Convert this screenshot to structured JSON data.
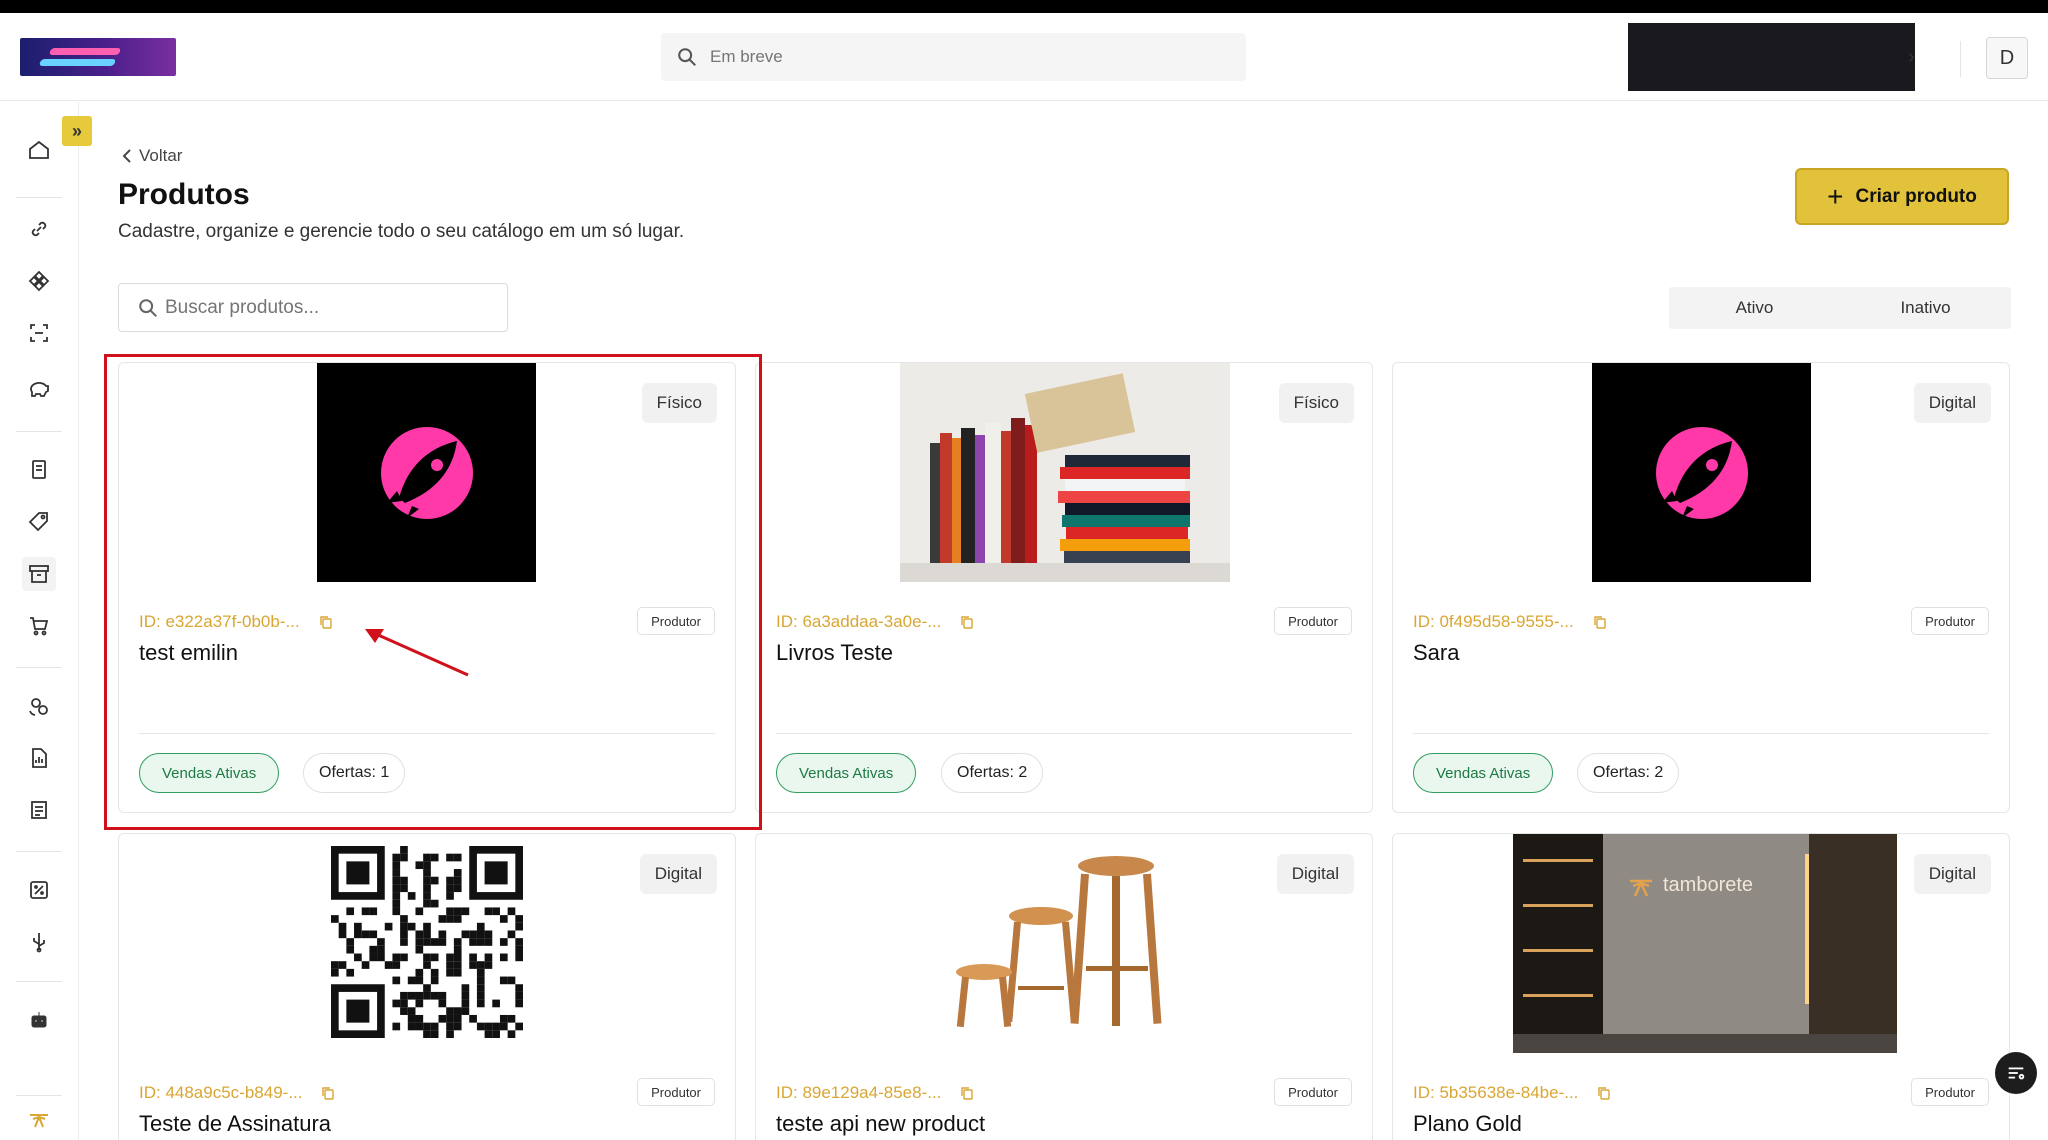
{
  "header": {
    "search_placeholder": "Em breve",
    "avatar_initial": "D"
  },
  "page": {
    "back_label": "Voltar",
    "title": "Produtos",
    "subtitle": "Cadastre, organize e gerencie todo o seu catálogo em um só lugar.",
    "create_button": "Criar produto",
    "search_placeholder": "Buscar produtos...",
    "tabs": [
      "Ativo",
      "Inativo"
    ]
  },
  "products": [
    {
      "type": "Físico",
      "id": "ID: e322a37f-0b0b-...",
      "role": "Produtor",
      "name": "test emilin",
      "sales": "Vendas Ativas",
      "offers": "Ofertas: 1",
      "image": "rocket-logo"
    },
    {
      "type": "Físico",
      "id": "ID: 6a3addaa-3a0e-...",
      "role": "Produtor",
      "name": "Livros Teste",
      "sales": "Vendas Ativas",
      "offers": "Ofertas: 2",
      "image": "books-photo"
    },
    {
      "type": "Digital",
      "id": "ID: 0f495d58-9555-...",
      "role": "Produtor",
      "name": "Sara",
      "sales": "Vendas Ativas",
      "offers": "Ofertas: 2",
      "image": "rocket-logo"
    },
    {
      "type": "Digital",
      "id": "ID: 448a9c5c-b849-...",
      "role": "Produtor",
      "name": "Teste de Assinatura",
      "image": "qr-code"
    },
    {
      "type": "Digital",
      "id": "ID: 89e129a4-85e8-...",
      "role": "Produtor",
      "name": "teste api new product",
      "image": "stools-photo"
    },
    {
      "type": "Digital",
      "id": "ID: 5b35638e-84be-...",
      "role": "Produtor",
      "name": "Plano Gold",
      "image": "tamborete-photo",
      "image_text": "tamborete"
    }
  ],
  "colors": {
    "accent": "#e3c23b",
    "id_text": "#d9a633",
    "sales_green": "#2f9e5e",
    "highlight_red": "#d0101a",
    "rocket_pink": "#ff3aa8"
  }
}
